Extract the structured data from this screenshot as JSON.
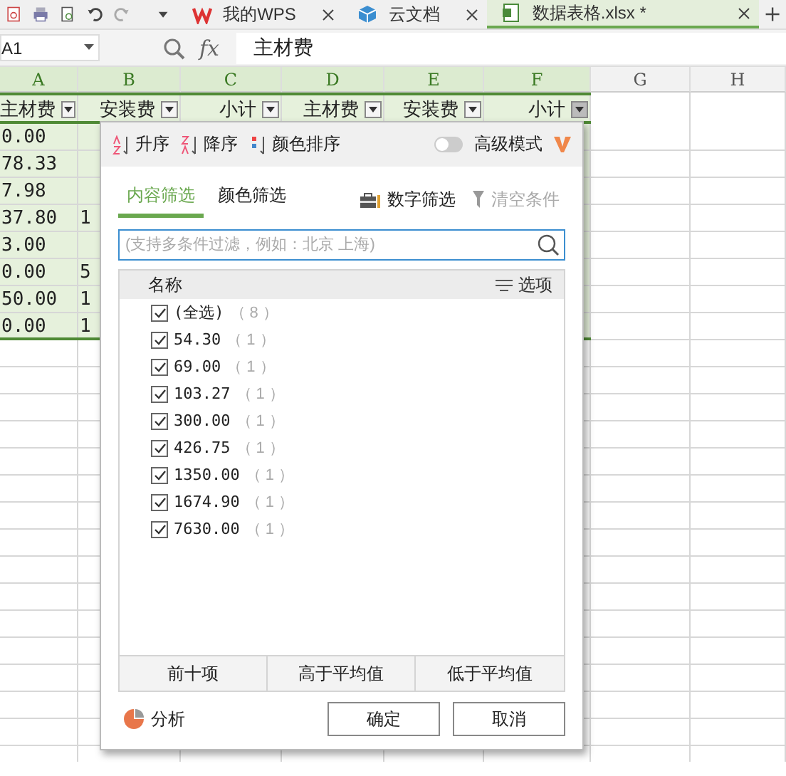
{
  "title_tabs": [
    {
      "label": "我的WPS",
      "kind": "wps",
      "selected": false
    },
    {
      "label": "云文档",
      "kind": "cloud",
      "selected": false
    },
    {
      "label": "数据表格.xlsx *",
      "kind": "sheet",
      "selected": true
    }
  ],
  "formula_bar": {
    "cell": "A1",
    "fx": "fx",
    "formula": "主材费"
  },
  "columns": [
    {
      "label": "A",
      "highlighted": true
    },
    {
      "label": "B",
      "highlighted": true
    },
    {
      "label": "C",
      "highlighted": true
    },
    {
      "label": "D",
      "highlighted": true
    },
    {
      "label": "E",
      "highlighted": true
    },
    {
      "label": "F",
      "highlighted": true
    },
    {
      "label": "G",
      "highlighted": false
    },
    {
      "label": "H",
      "highlighted": false
    }
  ],
  "header_row": [
    {
      "text": "主材费",
      "filter_open": false
    },
    {
      "text": "安装费",
      "filter_open": false
    },
    {
      "text": "小计",
      "filter_open": false
    },
    {
      "text": "主材费",
      "filter_open": false
    },
    {
      "text": "安装费",
      "filter_open": false
    },
    {
      "text": "小计",
      "filter_open": true
    }
  ],
  "rows": [
    [
      "0.00",
      ""
    ],
    [
      "78.33",
      ""
    ],
    [
      "7.98",
      ""
    ],
    [
      "37.80",
      "1"
    ],
    [
      "3.00",
      ""
    ],
    [
      "0.00",
      "5"
    ],
    [
      "50.00",
      "1"
    ],
    [
      "0.00",
      "1"
    ]
  ],
  "dialog": {
    "sort_buttons": [
      {
        "label": "升序",
        "kind": "asc"
      },
      {
        "label": "降序",
        "kind": "desc"
      },
      {
        "label": "颜色排序",
        "kind": "color"
      }
    ],
    "advanced": {
      "label": "高级模式",
      "on": false
    },
    "tabs": [
      {
        "label": "内容筛选",
        "selected": true
      },
      {
        "label": "颜色筛选",
        "selected": false
      }
    ],
    "number_filter": {
      "label": "数字筛选",
      "disabled": false
    },
    "clear": {
      "label": "清空条件",
      "disabled": true
    },
    "search": {
      "placeholder": "(支持多条件过滤，例如：北京 上海)"
    },
    "list": {
      "header": "名称",
      "options_label": "选项",
      "items": [
        {
          "label": "(全选)",
          "count": "（ 8 ）",
          "checked": true
        },
        {
          "label": "54.30",
          "count": "（ 1 ）",
          "checked": true
        },
        {
          "label": "69.00",
          "count": "（ 1 ）",
          "checked": true
        },
        {
          "label": "103.27",
          "count": "（ 1 ）",
          "checked": true
        },
        {
          "label": "300.00",
          "count": "（ 1 ）",
          "checked": true
        },
        {
          "label": "426.75",
          "count": "（ 1 ）",
          "checked": true
        },
        {
          "label": "1350.00",
          "count": "（ 1 ）",
          "checked": true
        },
        {
          "label": "1674.90",
          "count": "（ 1 ）",
          "checked": true
        },
        {
          "label": "7630.00",
          "count": "（ 1 ）",
          "checked": true
        }
      ]
    },
    "quick_buttons": [
      "前十项",
      "高于平均值",
      "低于平均值"
    ],
    "analyze": "分析",
    "buttons": [
      "确定",
      "取消"
    ]
  }
}
